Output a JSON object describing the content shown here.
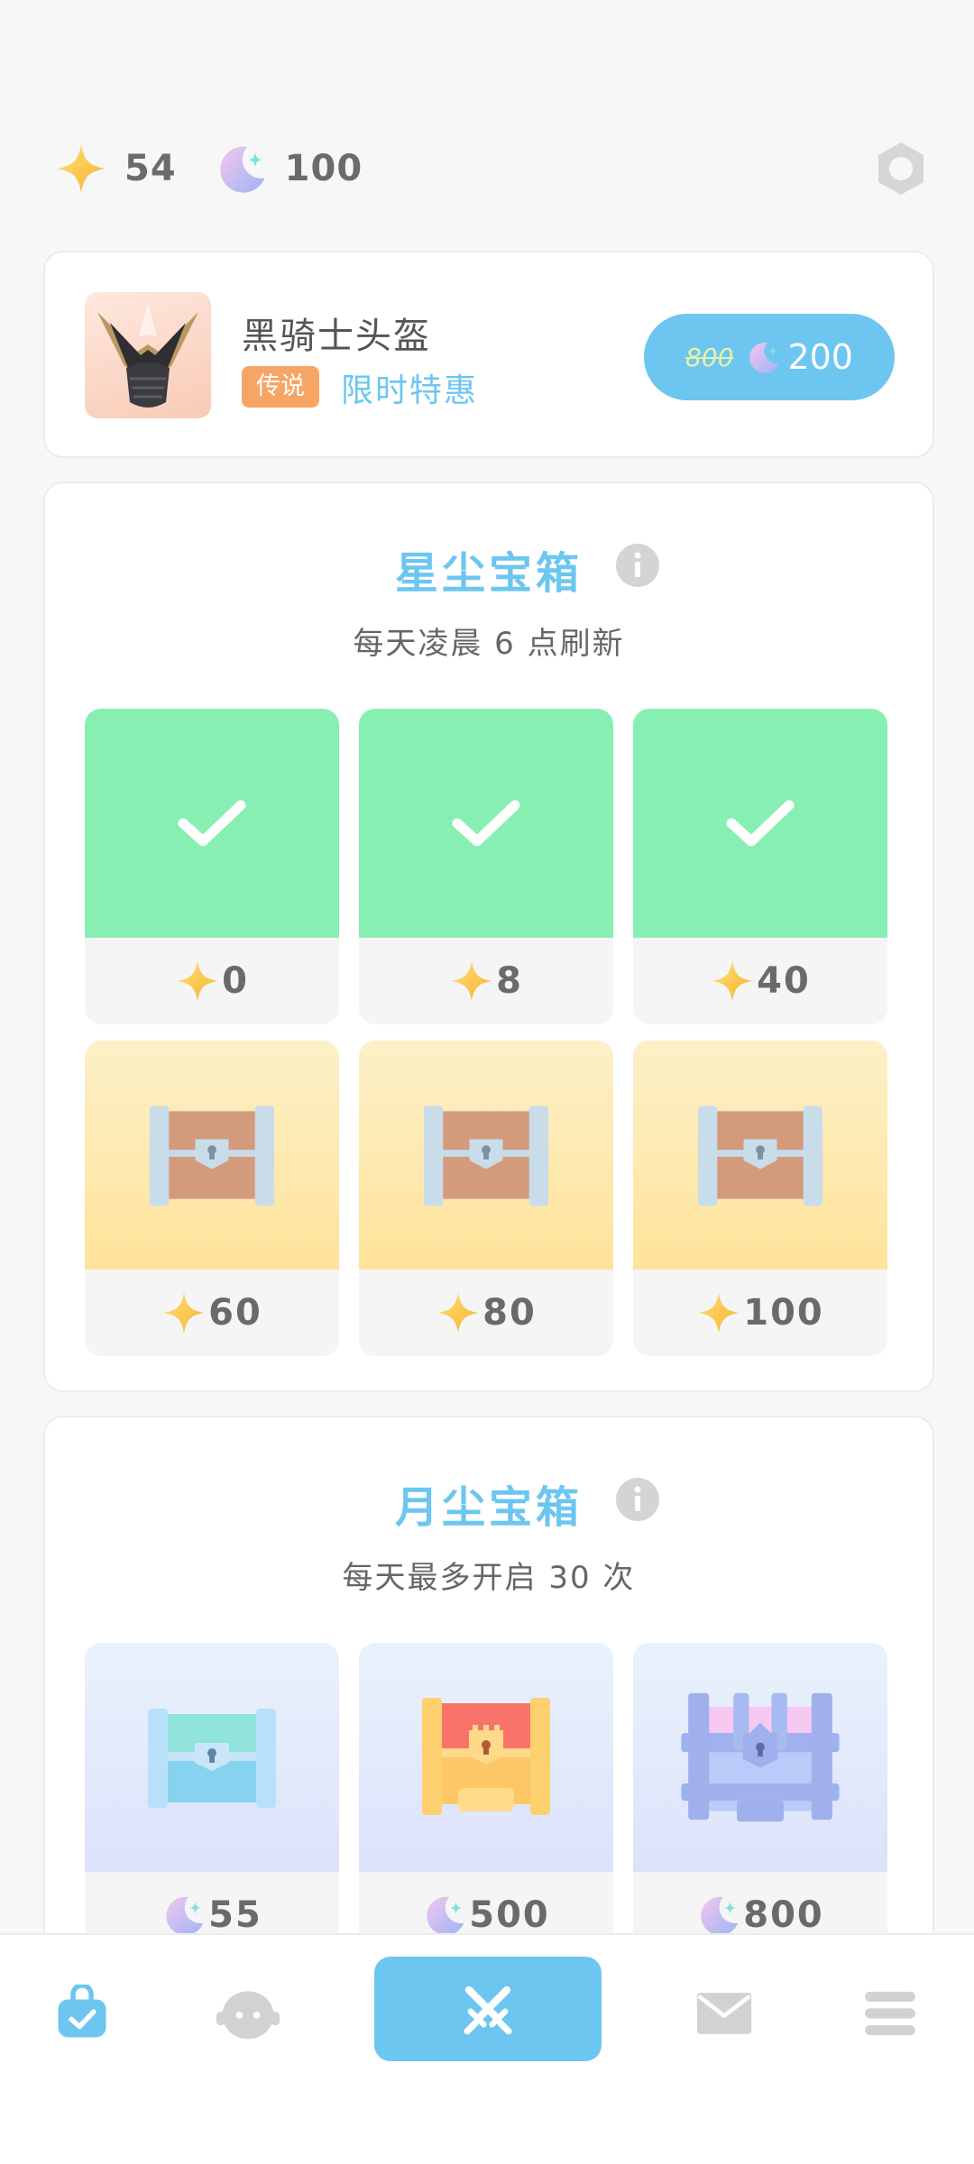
{
  "currency": {
    "stardust": "54",
    "moondust": "100"
  },
  "offer": {
    "name": "黑骑士头盔",
    "rarity": "传说",
    "promo": "限时特惠",
    "old_price": "800",
    "new_price": "200"
  },
  "stardust_chest": {
    "title": "星尘宝箱",
    "subtitle": "每天凌晨 6 点刷新",
    "tiers": [
      {
        "cost": "0",
        "state": "claimed"
      },
      {
        "cost": "8",
        "state": "claimed"
      },
      {
        "cost": "40",
        "state": "claimed"
      },
      {
        "cost": "60",
        "state": "locked"
      },
      {
        "cost": "80",
        "state": "locked"
      },
      {
        "cost": "100",
        "state": "locked"
      }
    ]
  },
  "moondust_chest": {
    "title": "月尘宝箱",
    "subtitle": "每天最多开启 30 次",
    "tiers": [
      {
        "cost": "55",
        "chest": "teal-chest"
      },
      {
        "cost": "500",
        "chest": "red-gold-chest"
      },
      {
        "cost": "800",
        "chest": "purple-chest"
      }
    ]
  },
  "nav": {
    "items": [
      "shop-bag-icon",
      "character-icon",
      "battle-swords-icon",
      "mail-icon",
      "menu-icon"
    ],
    "active": "shop-bag-icon"
  },
  "colors": {
    "accent": "#6cc6f0",
    "claimed": "#87efb2",
    "rarity_legend": "#f7a564",
    "star": "#fbc84a"
  }
}
